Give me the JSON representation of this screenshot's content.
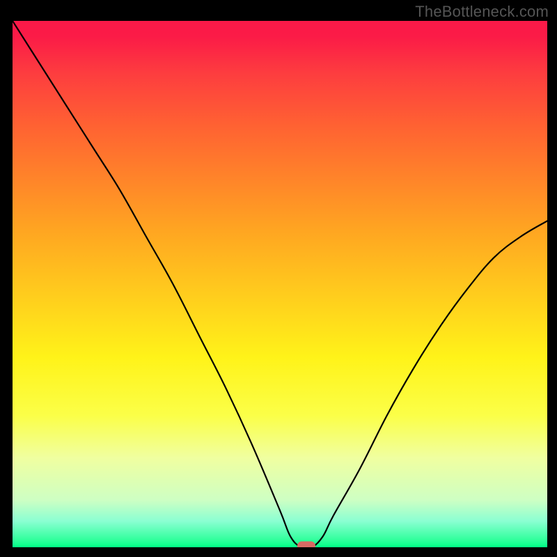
{
  "watermark": "TheBottleneck.com",
  "chart_data": {
    "type": "line",
    "title": "",
    "xlabel": "",
    "ylabel": "",
    "xlim": [
      0,
      100
    ],
    "ylim": [
      0,
      100
    ],
    "grid": false,
    "series": [
      {
        "name": "bottleneck-curve",
        "x": [
          0,
          5,
          10,
          15,
          20,
          25,
          30,
          35,
          40,
          45,
          50,
          52,
          54,
          56,
          58,
          60,
          65,
          70,
          75,
          80,
          85,
          90,
          95,
          100
        ],
        "values": [
          100,
          92,
          84,
          76,
          68,
          59,
          50,
          40,
          30,
          19,
          7,
          2,
          0,
          0,
          2,
          6,
          15,
          25,
          34,
          42,
          49,
          55,
          59,
          62
        ]
      }
    ],
    "marker": {
      "x": 55,
      "y": 0,
      "color": "#d86a64"
    },
    "background_gradient": {
      "type": "linear-vertical",
      "stops": [
        {
          "pos": 0,
          "color": "#fb1948"
        },
        {
          "pos": 20,
          "color": "#ff6232"
        },
        {
          "pos": 40,
          "color": "#ffa621"
        },
        {
          "pos": 64,
          "color": "#fff319"
        },
        {
          "pos": 83,
          "color": "#f0ffa0"
        },
        {
          "pos": 95,
          "color": "#8bffd2"
        },
        {
          "pos": 100,
          "color": "#00ff86"
        }
      ]
    }
  }
}
